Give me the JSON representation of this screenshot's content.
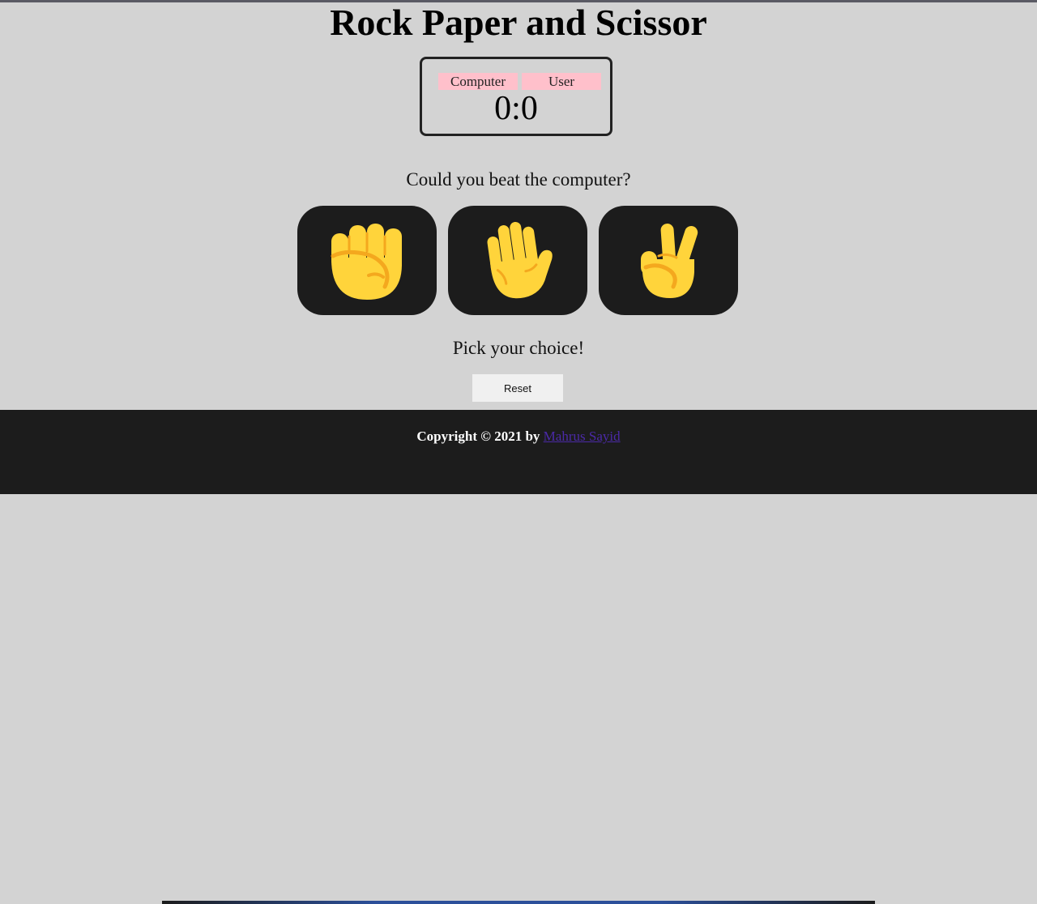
{
  "title": "Rock Paper and Scissor",
  "scoreboard": {
    "computer_label": "Computer",
    "user_label": "User",
    "score": "0:0"
  },
  "question": "Could you beat the computer?",
  "choices": [
    {
      "name": "rock",
      "icon": "raised-fist-icon"
    },
    {
      "name": "paper",
      "icon": "raised-hand-icon"
    },
    {
      "name": "scissors",
      "icon": "victory-hand-icon"
    }
  ],
  "status": "Pick your choice!",
  "reset_label": "Reset",
  "footer": {
    "copyright_prefix": "Copyright © 2021 by",
    "author_link": "Mahrus Sayid"
  },
  "colors": {
    "background": "#d3d3d3",
    "card": "#1c1c1c",
    "badge": "#ffc0cb",
    "emoji": "#ffd43b",
    "link": "#4b2aa8"
  }
}
